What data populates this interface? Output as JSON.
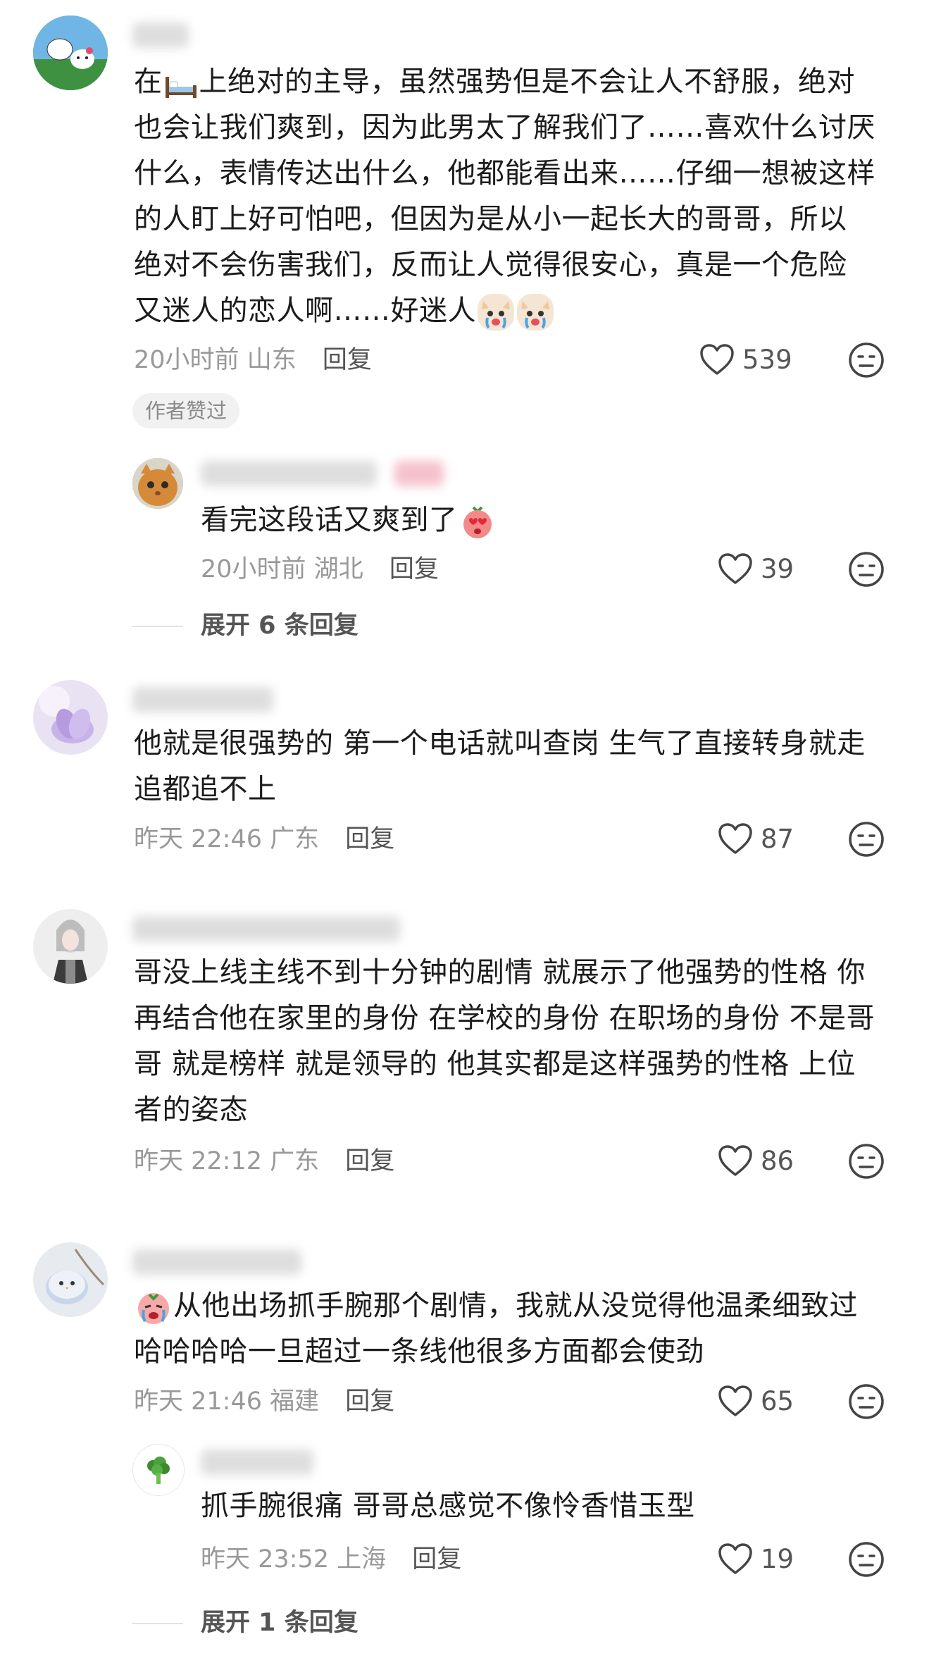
{
  "comments": [
    {
      "lines": [
        "上绝对的主导，虽然强势但是不会让人不舒服，绝对",
        "也会让我们爽到，因为此男太了解我们了……喜欢什么讨厌",
        "什么，表情传达出什么，他都能看出来……仔细一想被这样",
        "的人盯上好可怕吧，但因为是从小一起长大的哥哥，所以",
        "绝对不会伤害我们，反而让人觉得很安心，真是一个危险",
        "又迷人的恋人啊……好迷人"
      ],
      "first_prefix": "在",
      "time": "20小时前",
      "location": "山东",
      "reply_label": "回复",
      "likes": "539",
      "badge": "作者赞过"
    },
    {
      "lines": [
        "看完这段话又爽到了"
      ],
      "time": "20小时前",
      "location": "湖北",
      "reply_label": "回复",
      "likes": "39",
      "expand": "展开 6 条回复"
    },
    {
      "lines": [
        "他就是很强势的 第一个电话就叫查岗 生气了直接转身就走",
        "追都追不上"
      ],
      "time": "昨天 22:46",
      "location": "广东",
      "reply_label": "回复",
      "likes": "87"
    },
    {
      "lines": [
        "哥没上线主线不到十分钟的剧情 就展示了他强势的性格 你",
        "再结合他在家里的身份 在学校的身份 在职场的身份 不是哥",
        "哥 就是榜样 就是领导的 他其实都是这样强势的性格 上位",
        "者的姿态"
      ],
      "time": "昨天 22:12",
      "location": "广东",
      "reply_label": "回复",
      "likes": "86"
    },
    {
      "lines": [
        "从他出场抓手腕那个剧情，我就从没觉得他温柔细致过",
        "哈哈哈哈一旦超过一条线他很多方面都会使劲"
      ],
      "time": "昨天 21:46",
      "location": "福建",
      "reply_label": "回复",
      "likes": "65"
    },
    {
      "lines": [
        "抓手腕很痛 哥哥总感觉不像怜香惜玉型"
      ],
      "time": "昨天 23:52",
      "location": "上海",
      "reply_label": "回复",
      "likes": "19",
      "expand": "展开 1 条回复"
    }
  ],
  "icons": {
    "like": "heart-outline-icon",
    "dislike": "meh-face-icon"
  },
  "colors": {
    "meta": "#999999",
    "text": "#1c1c1c",
    "badge_bg": "#f1f1f1"
  }
}
